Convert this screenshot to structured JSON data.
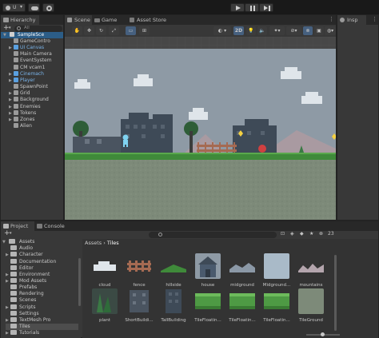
{
  "toolbar": {
    "account_label": "U",
    "play_icon": "play-icon",
    "pause_icon": "pause-icon",
    "step_icon": "step-icon"
  },
  "hierarchy": {
    "tab_label": "Hierarchy",
    "search_placeholder": "All",
    "scene_name": "SampleSce",
    "items": [
      {
        "label": "GameContro",
        "blue": false,
        "arrow": false
      },
      {
        "label": "UI Canvas",
        "blue": true,
        "arrow": true
      },
      {
        "label": "Main Camera",
        "blue": false,
        "arrow": false
      },
      {
        "label": "EventSystem",
        "blue": false,
        "arrow": false
      },
      {
        "label": "CM vcam1",
        "blue": false,
        "arrow": false
      },
      {
        "label": "Cinemach",
        "blue": true,
        "arrow": true
      },
      {
        "label": "Player",
        "blue": true,
        "arrow": true
      },
      {
        "label": "SpawnPoint",
        "blue": false,
        "arrow": false
      },
      {
        "label": "Grid",
        "blue": false,
        "arrow": true
      },
      {
        "label": "Background",
        "blue": false,
        "arrow": true
      },
      {
        "label": "Enemies",
        "blue": false,
        "arrow": true
      },
      {
        "label": "Tokens",
        "blue": false,
        "arrow": true
      },
      {
        "label": "Zones",
        "blue": false,
        "arrow": true
      },
      {
        "label": "Alien",
        "blue": false,
        "arrow": false
      }
    ]
  },
  "scene_tabs": {
    "scene": "Scene",
    "game": "Game",
    "asset_store": "Asset Store"
  },
  "scene_toolbar": {
    "mode_2d": "2D"
  },
  "inspector": {
    "tab_label": "Insp"
  },
  "bottom_tabs": {
    "project": "Project",
    "console": "Console"
  },
  "project": {
    "hidden_count": "23",
    "assets_root": "Assets",
    "folders": [
      {
        "label": "Audio",
        "depth": 1,
        "arrow": false
      },
      {
        "label": "Character",
        "depth": 1,
        "arrow": true
      },
      {
        "label": "Documentation",
        "depth": 1,
        "arrow": false
      },
      {
        "label": "Editor",
        "depth": 1,
        "arrow": false
      },
      {
        "label": "Environment",
        "depth": 1,
        "arrow": true
      },
      {
        "label": "Mod Assets",
        "depth": 1,
        "arrow": true
      },
      {
        "label": "Prefabs",
        "depth": 1,
        "arrow": false
      },
      {
        "label": "Rendering",
        "depth": 1,
        "arrow": false
      },
      {
        "label": "Scenes",
        "depth": 1,
        "arrow": false
      },
      {
        "label": "Scripts",
        "depth": 1,
        "arrow": true
      },
      {
        "label": "Settings",
        "depth": 1,
        "arrow": false
      },
      {
        "label": "TextMesh Pro",
        "depth": 1,
        "arrow": true
      },
      {
        "label": "Tiles",
        "depth": 1,
        "arrow": false,
        "selected": true
      },
      {
        "label": "Tutorials",
        "depth": 1,
        "arrow": true
      }
    ],
    "breadcrumb": [
      "Assets",
      "Tiles"
    ],
    "assets": [
      {
        "label": "cloud",
        "kind": "cloud"
      },
      {
        "label": "fence",
        "kind": "fence"
      },
      {
        "label": "hillside",
        "kind": "hillside"
      },
      {
        "label": "house",
        "kind": "house"
      },
      {
        "label": "midground",
        "kind": "midground"
      },
      {
        "label": "Midground...",
        "kind": "midground2"
      },
      {
        "label": "mountains",
        "kind": "mountains"
      },
      {
        "label": "plant",
        "kind": "plant"
      },
      {
        "label": "ShortBuildi...",
        "kind": "shortbuilding"
      },
      {
        "label": "TallBuilding",
        "kind": "tallbuilding"
      },
      {
        "label": "TileFloatin...",
        "kind": "grass"
      },
      {
        "label": "TileFloatin...",
        "kind": "grass"
      },
      {
        "label": "TileFloatin...",
        "kind": "grass"
      },
      {
        "label": "TileGround",
        "kind": "ground"
      }
    ]
  },
  "colors": {
    "accent_blue": "#46607f",
    "selection": "#2c5d87",
    "sky": "#8e9aa5",
    "grass": "#3f8a3a",
    "ground": "#7d8a79"
  }
}
